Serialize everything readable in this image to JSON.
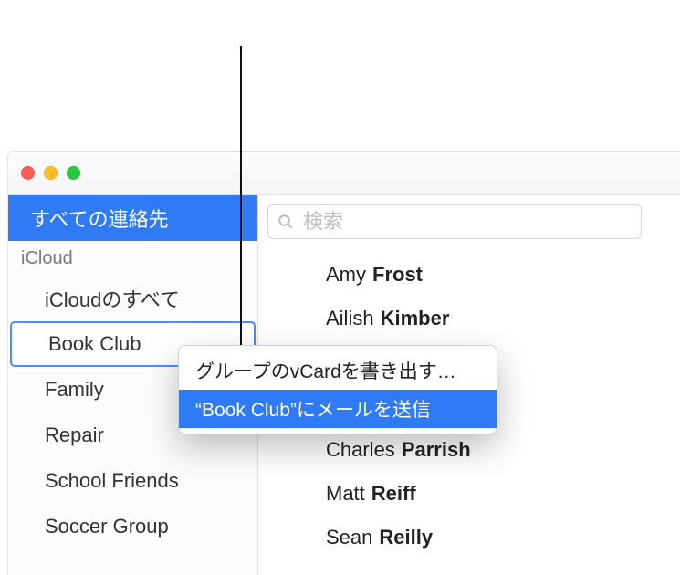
{
  "window": {
    "traffic": [
      "close",
      "minimize",
      "zoom"
    ]
  },
  "sidebar": {
    "all_label": "すべての連絡先",
    "account_label": "iCloud",
    "items": [
      {
        "label": "iCloudのすべて"
      },
      {
        "label": "Book Club"
      },
      {
        "label": "Family"
      },
      {
        "label": "Repair"
      },
      {
        "label": "School Friends"
      },
      {
        "label": "Soccer Group"
      }
    ]
  },
  "search": {
    "placeholder": "検索"
  },
  "contacts": [
    {
      "first": "Amy",
      "last": "Frost"
    },
    {
      "first": "Ailish",
      "last": "Kimber"
    },
    {
      "first": "Charles",
      "last": "Parrish"
    },
    {
      "first": "Matt",
      "last": "Reiff"
    },
    {
      "first": "Sean",
      "last": "Reilly"
    }
  ],
  "context_menu": {
    "items": [
      {
        "label": "グループのvCardを書き出す…"
      },
      {
        "label": "“Book Club”にメールを送信"
      }
    ]
  }
}
